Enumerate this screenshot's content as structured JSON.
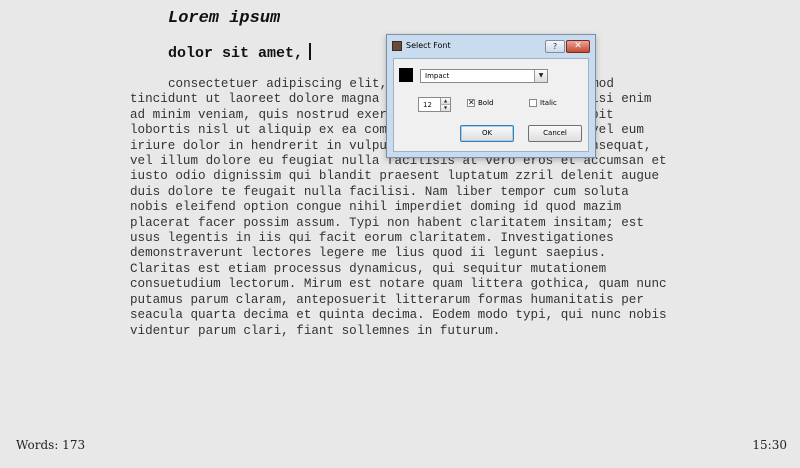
{
  "document": {
    "title": "Lorem ipsum",
    "subtitle": "dolor sit amet,",
    "body": "consectetuer adipiscing elit, sed diam nonummy nibh euismod tincidunt ut laoreet dolore magna aliquam erat volutpat. Ut wisi enim ad minim veniam, quis nostrud exerci tation ullamcorper suscipit lobortis nisl ut aliquip ex ea commodo consequat. Duis autem vel eum iriure dolor in hendrerit in vulputate velit esse molestie consequat, vel illum dolore eu feugiat nulla facilisis at vero eros et accumsan et iusto odio dignissim qui blandit praesent luptatum zzril delenit augue duis dolore te feugait nulla facilisi. Nam liber tempor cum soluta nobis eleifend option congue nihil imperdiet doming id quod mazim placerat facer possim assum. Typi non habent claritatem insitam; est usus legentis in iis qui facit eorum claritatem. Investigationes demonstraverunt lectores legere me lius quod ii legunt saepius. Claritas est etiam processus dynamicus, qui sequitur mutationem consuetudium lectorum. Mirum est notare quam littera gothica, quam nunc putamus parum claram, anteposuerit litterarum formas humanitatis per seacula quarta decima et quinta decima. Eodem modo typi, qui nunc nobis videntur parum clari, fiant sollemnes in futurum."
  },
  "status": {
    "words": "Words: 173",
    "time": "15:30"
  },
  "dialog": {
    "title": "Select Font",
    "help_label": "?",
    "close_label": "✕",
    "color_value": "#000000",
    "font_value": "Impact",
    "dropdown_glyph": "▼",
    "size_value": "12",
    "spin_up_glyph": "▲",
    "spin_down_glyph": "▼",
    "bold_label": "Bold",
    "bold_checked": true,
    "bold_check_glyph": "✕",
    "italic_label": "Italic",
    "italic_checked": false,
    "ok_label": "OK",
    "cancel_label": "Cancel"
  }
}
